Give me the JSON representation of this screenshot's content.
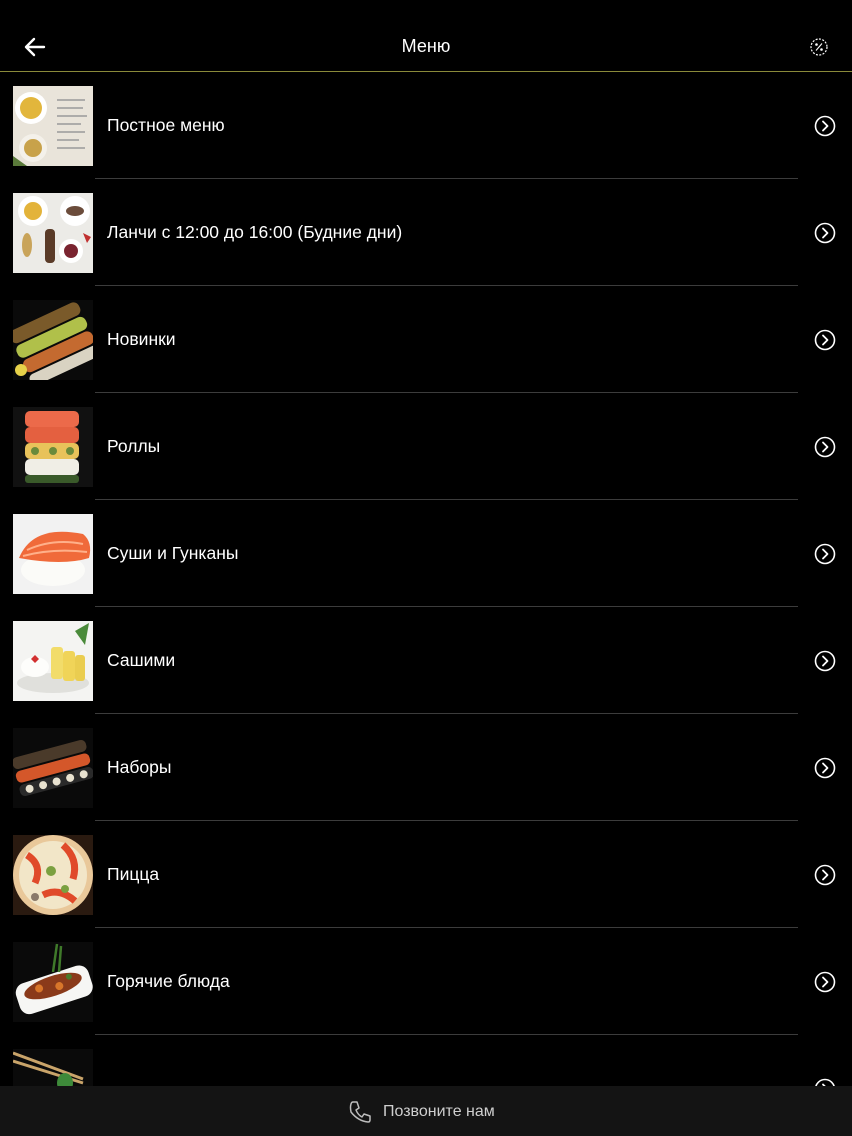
{
  "header": {
    "title": "Меню",
    "back_icon": "arrow-left-icon",
    "promo_icon": "percent-badge-icon"
  },
  "menu": {
    "items": [
      {
        "label": "Постное меню",
        "thumb": "lenten-menu-photo"
      },
      {
        "label": "Ланчи с 12:00 до 16:00 (Будние дни)",
        "thumb": "lunch-photo"
      },
      {
        "label": "Новинки",
        "thumb": "new-items-photo"
      },
      {
        "label": "Роллы",
        "thumb": "rolls-photo"
      },
      {
        "label": "Суши и Гунканы",
        "thumb": "sushi-photo"
      },
      {
        "label": "Сашими",
        "thumb": "sashimi-photo"
      },
      {
        "label": "Наборы",
        "thumb": "sets-photo"
      },
      {
        "label": "Пицца",
        "thumb": "pizza-photo"
      },
      {
        "label": "Горячие блюда",
        "thumb": "hot-dishes-photo"
      },
      {
        "label": "",
        "thumb": "chopsticks-photo"
      }
    ]
  },
  "footer": {
    "call_label": "Позвоните нам",
    "call_icon": "phone-icon"
  },
  "colors": {
    "background": "#000000",
    "header_border": "#8a8a3a",
    "divider": "#3c3c3c",
    "footer_bg": "#141414",
    "text": "#ffffff"
  }
}
